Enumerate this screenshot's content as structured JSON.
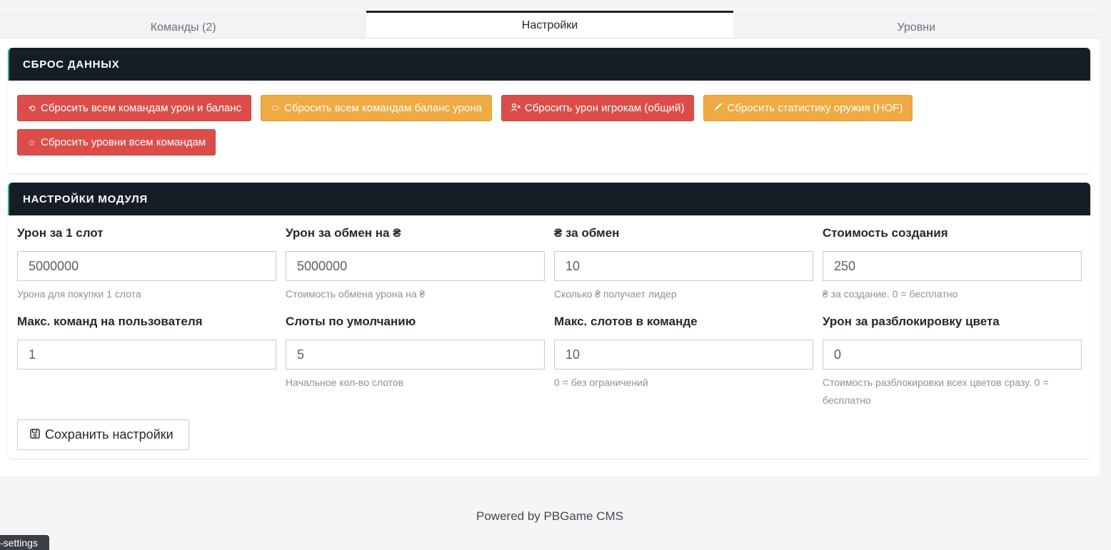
{
  "tabs": [
    {
      "label": "Команды (2)",
      "active": false
    },
    {
      "label": "Настройки",
      "active": true
    },
    {
      "label": "Уровни",
      "active": false
    }
  ],
  "reset_panel": {
    "title": "СБРОС ДАННЫХ",
    "buttons": [
      {
        "label": "Сбросить всем командам урон и баланс",
        "color": "#dc4d4a",
        "icon": "reset-icon"
      },
      {
        "label": "Сбросить всем командам баланс урона",
        "color": "#efaa43",
        "icon": "coins-icon"
      },
      {
        "label": "Сбросить урон игрокам (общий)",
        "color": "#dc4d4a",
        "icon": "user-x-icon"
      },
      {
        "label": "Сбросить статистику оружия (HOF)",
        "color": "#efaa43",
        "icon": "knife-icon"
      },
      {
        "label": "Сбросить уровни всем командам",
        "color": "#dc4d4a",
        "icon": "star-icon"
      }
    ]
  },
  "settings_panel": {
    "title": "НАСТРОЙКИ МОДУЛЯ",
    "fields": [
      {
        "label": "Урон за 1 слот",
        "value": "5000000",
        "help": "Урона для покупки 1 слота"
      },
      {
        "label": "Урон за обмен на ₴",
        "value": "5000000",
        "help": "Стоимость обмена урона на ₴"
      },
      {
        "label": "₴ за обмен",
        "value": "10",
        "help": "Сколько ₴ получает лидер"
      },
      {
        "label": "Стоимость создания",
        "value": "250",
        "help": "₴ за создание. 0 = бесплатно"
      },
      {
        "label": "Макс. команд на пользователя",
        "value": "1",
        "help": ""
      },
      {
        "label": "Слоты по умолчанию",
        "value": "5",
        "help": "Начальное кол-во слотов"
      },
      {
        "label": "Макс. слотов в команде",
        "value": "10",
        "help": "0 = без ограничений"
      },
      {
        "label": "Урон за разблокировку цвета",
        "value": "0",
        "help": "Стоимость разблокировки всех цветов сразу. 0 = бесплатно"
      }
    ],
    "save_label": "Сохранить настройки"
  },
  "footer": "Powered by PBGame CMS",
  "tooltip": "-settings",
  "colors": {
    "header_bg": "#161d26",
    "danger": "#dc4d4a",
    "warning": "#efaa43",
    "accent": "#2fb377"
  }
}
